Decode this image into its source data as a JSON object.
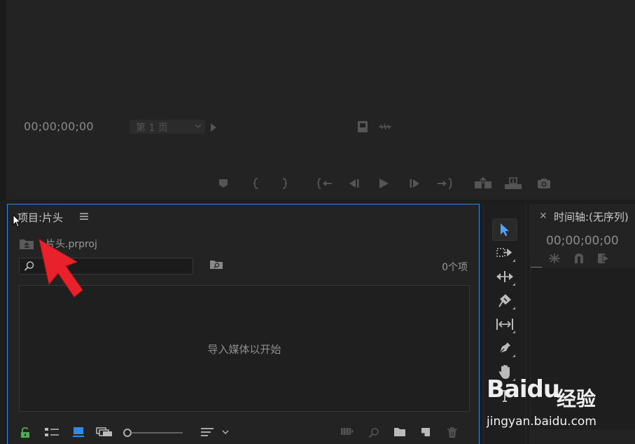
{
  "program_monitor": {
    "timecode": "00;00;00;00",
    "page_select": "第 1 页"
  },
  "project_panel": {
    "title": "项目:片头",
    "project_file": "片头.prproj",
    "search": {
      "value": "",
      "placeholder": ""
    },
    "item_count": "0个项",
    "empty_hint": "导入媒体以开始"
  },
  "timeline_panel": {
    "close_glyph": "×",
    "title": "时间轴:(无序列)",
    "timecode": "00;00;00;00"
  },
  "watermark": {
    "logo_a": "Bai",
    "logo_b": "du",
    "logo_cn": "经验",
    "url": "jingyan.baidu.com"
  },
  "colors": {
    "accent_blue": "#2d8ceb",
    "selection_tool": "#4da3ff",
    "lock_green": "#4caf50",
    "annotation_red": "#e8212b"
  }
}
